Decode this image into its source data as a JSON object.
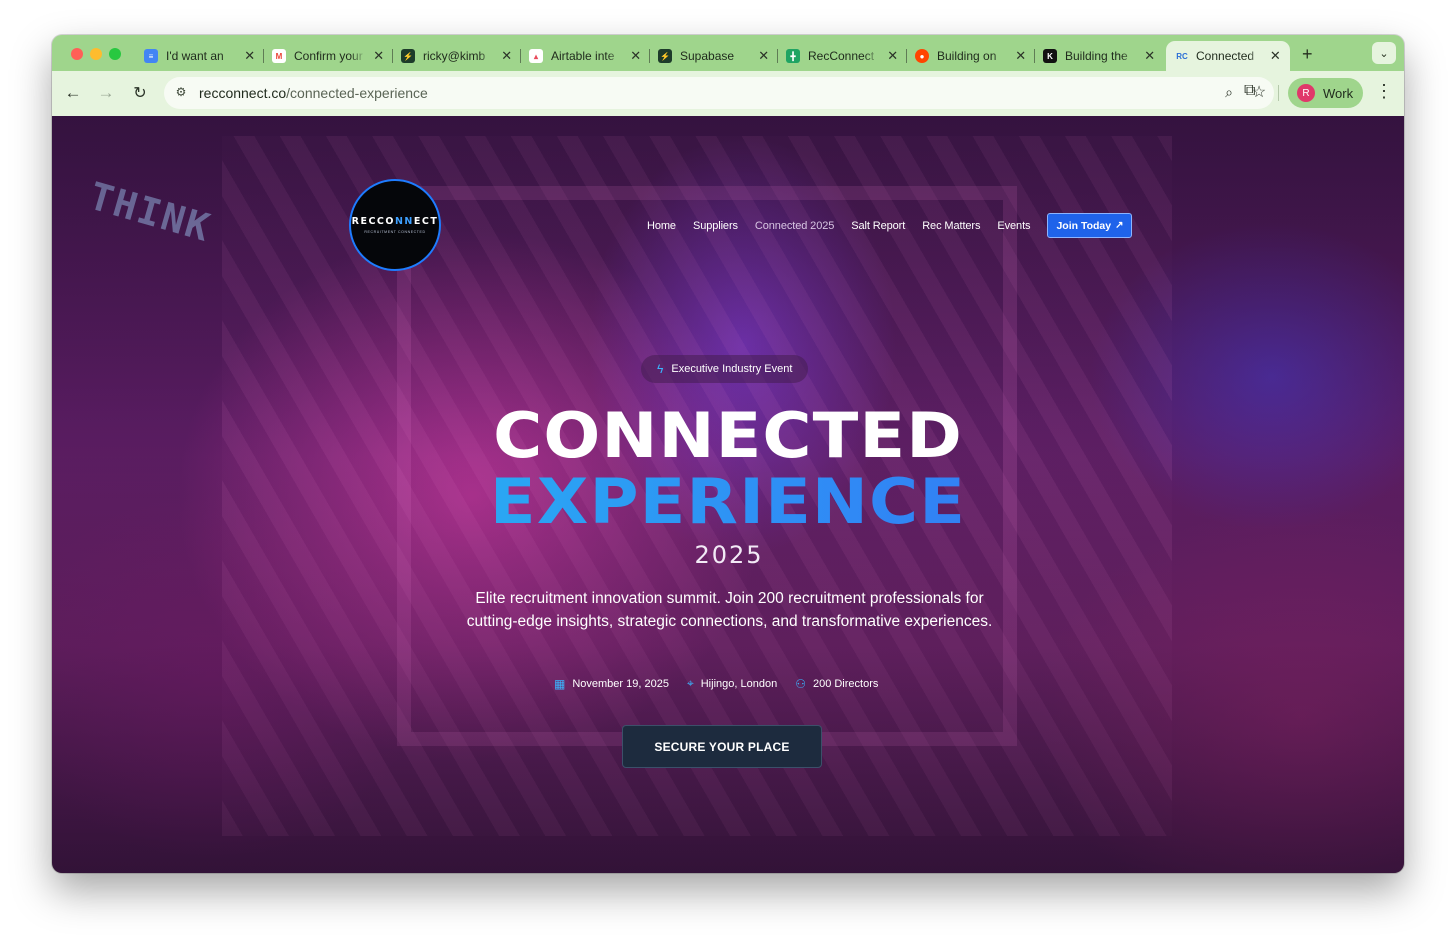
{
  "browser": {
    "tabs": [
      {
        "title": "I'd want an",
        "favicon_color": "#4285f4",
        "favicon_icon": "docs-icon"
      },
      {
        "title": "Confirm your",
        "favicon_color": "#ea4335",
        "favicon_icon": "gmail-icon"
      },
      {
        "title": "ricky@kimb",
        "favicon_color": "#1d3b2a",
        "favicon_icon": "supabase-icon"
      },
      {
        "title": "Airtable inte",
        "favicon_color": "#e94b5b",
        "favicon_icon": "airtable-icon"
      },
      {
        "title": "Supabase",
        "favicon_color": "#1d3b2a",
        "favicon_icon": "supabase-icon"
      },
      {
        "title": "RecConnect",
        "favicon_color": "#1fa463",
        "favicon_icon": "sheets-icon"
      },
      {
        "title": "Building on",
        "favicon_color": "#ff4500",
        "favicon_icon": "reddit-icon"
      },
      {
        "title": "Building the",
        "favicon_color": "#111111",
        "favicon_icon": "kx-icon"
      },
      {
        "title": "Connected",
        "favicon_color": "#2b6fd6",
        "favicon_icon": "rc-icon",
        "favicon_text": "RC",
        "active": true
      }
    ],
    "url_host": "recconnect.co",
    "url_path": "/connected-experience",
    "profile_initial": "R",
    "profile_name": "Work"
  },
  "site": {
    "logo_main": "RECCO",
    "logo_accent": "NN",
    "logo_end": "ECT",
    "logo_tagline": "RECRUITMENT CONNECTED",
    "nav": [
      "Home",
      "Suppliers",
      "Connected 2025",
      "Salt Report",
      "Rec Matters",
      "Events"
    ],
    "cta_header": "Join Today"
  },
  "hero": {
    "badge": "Executive Industry Event",
    "title_line1": "CONNECTED",
    "title_line2": "EXPERIENCE",
    "year": "2025",
    "description": "Elite recruitment innovation summit. Join 200 recruitment professionals for cutting-edge insights, strategic connections, and transformative experiences.",
    "meta": [
      {
        "icon": "calendar-icon",
        "text": "November 19, 2025"
      },
      {
        "icon": "location-pin-icon",
        "text": "Hijingo, London"
      },
      {
        "icon": "people-icon",
        "text": "200 Directors"
      }
    ],
    "cta": "SECURE YOUR PLACE"
  },
  "colors": {
    "accent_blue": "#1f63ea",
    "title_gradient": [
      "#22d0f0",
      "#3a5cf2"
    ],
    "icon_cyan": "#3ab6ff",
    "browser_frame": "#9fd58c"
  }
}
